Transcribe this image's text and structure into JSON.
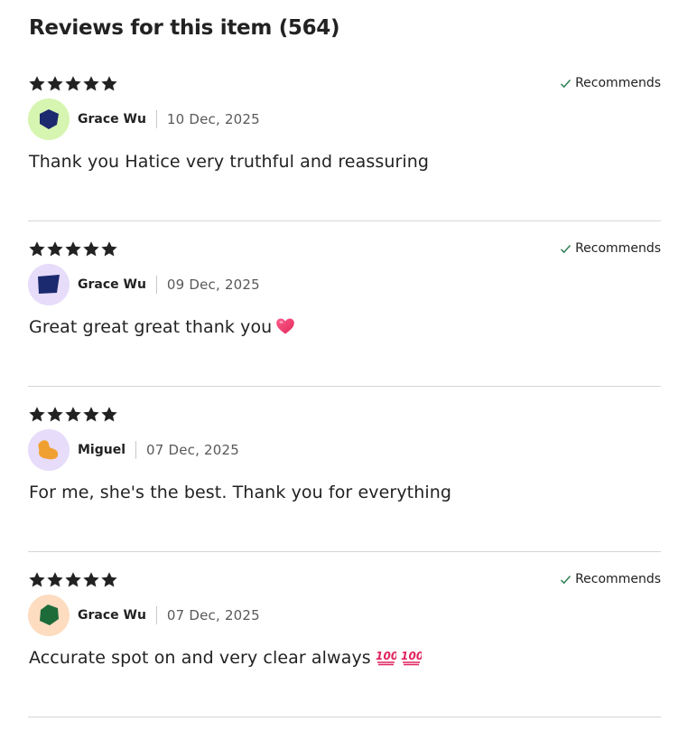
{
  "section": {
    "title": "Reviews for this item (564)"
  },
  "reviews": [
    {
      "rating": 5,
      "recommends": "Recommends",
      "author": "Grace Wu",
      "date": "10 Dec, 2025",
      "text": "Thank you Hatice very truthful and reassuring",
      "avatar": {
        "bg": "#d6f5b0",
        "shape": "pentagon",
        "shape_color": "#1b2a6e"
      },
      "emoji": []
    },
    {
      "rating": 5,
      "recommends": "Recommends",
      "author": "Grace Wu",
      "date": "09 Dec, 2025",
      "text": "Great great great thank you",
      "avatar": {
        "bg": "#e7dcfa",
        "shape": "trapezoid",
        "shape_color": "#1b2a6e"
      },
      "emoji": [
        "heart-emoji"
      ]
    },
    {
      "rating": 5,
      "recommends": "",
      "author": "Miguel",
      "date": "07 Dec, 2025",
      "text": "For me, she's the best. Thank you for everything",
      "avatar": {
        "bg": "#e7dcfa",
        "shape": "blob",
        "shape_color": "#f0a030"
      },
      "emoji": []
    },
    {
      "rating": 5,
      "recommends": "Recommends",
      "author": "Grace Wu",
      "date": "07 Dec, 2025",
      "text": "Accurate spot on and very clear always",
      "avatar": {
        "bg": "#fddcc0",
        "shape": "pentagon",
        "shape_color": "#1e6b3a"
      },
      "emoji": [
        "hundred-points-emoji",
        "hundred-points-emoji"
      ]
    }
  ],
  "colors": {
    "star": "#222222",
    "check": "#2a7d4f",
    "divider": "#d6d6d6",
    "date": "#595959"
  }
}
